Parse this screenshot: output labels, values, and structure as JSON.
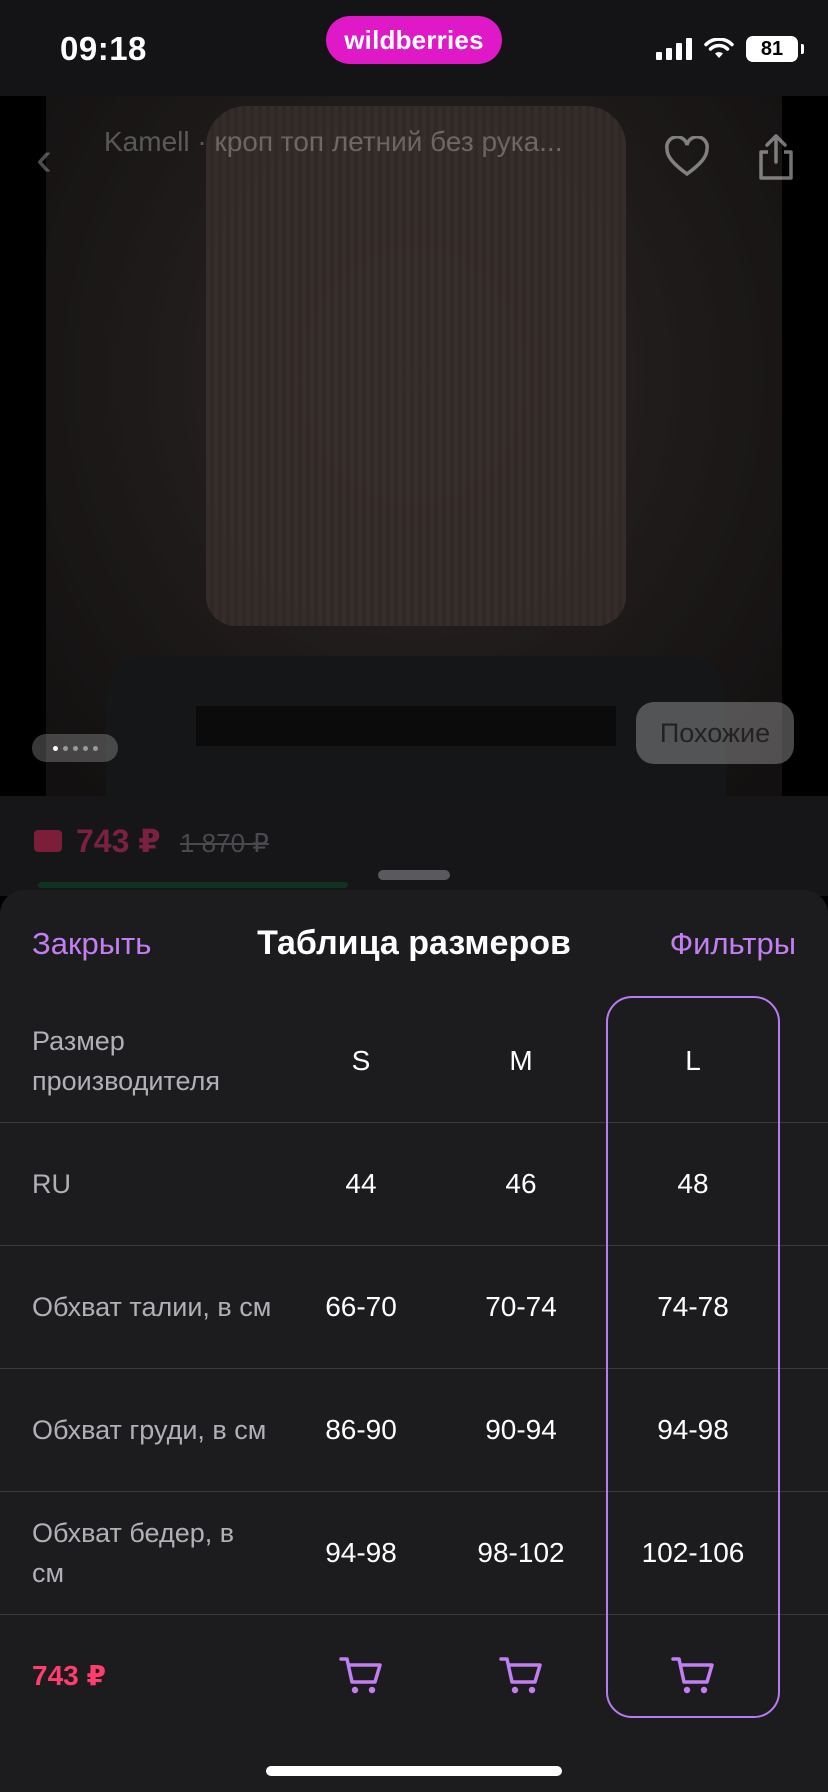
{
  "status_bar": {
    "time": "09:18",
    "brand": "wildberries",
    "battery": "81",
    "brand_color": "#e019c8"
  },
  "product": {
    "title": "Kamell · кроп топ летний без рука...",
    "similar_label": "Похожие",
    "price": "743 ₽",
    "old_price": "1 870 ₽"
  },
  "sheet": {
    "close_label": "Закрыть",
    "title": "Таблица размеров",
    "filters_label": "Фильтры",
    "accent_color": "#c37ef2"
  },
  "table": {
    "header": {
      "label": "Размер производителя",
      "sizes": [
        "S",
        "M",
        "L"
      ]
    },
    "rows": [
      {
        "label": "RU",
        "values": [
          "44",
          "46",
          "48"
        ]
      },
      {
        "label": "Обхват талии, в см",
        "values": [
          "66-70",
          "70-74",
          "74-78"
        ]
      },
      {
        "label": "Обхват груди, в см",
        "values": [
          "86-90",
          "90-94",
          "94-98"
        ]
      },
      {
        "label": "Обхват бедер, в см",
        "values": [
          "94-98",
          "98-102",
          "102-106"
        ]
      }
    ],
    "cart_price": "743 ₽",
    "selected_size": "L",
    "cart_icon": "cart-icon",
    "price_color": "#ff3d6e"
  }
}
